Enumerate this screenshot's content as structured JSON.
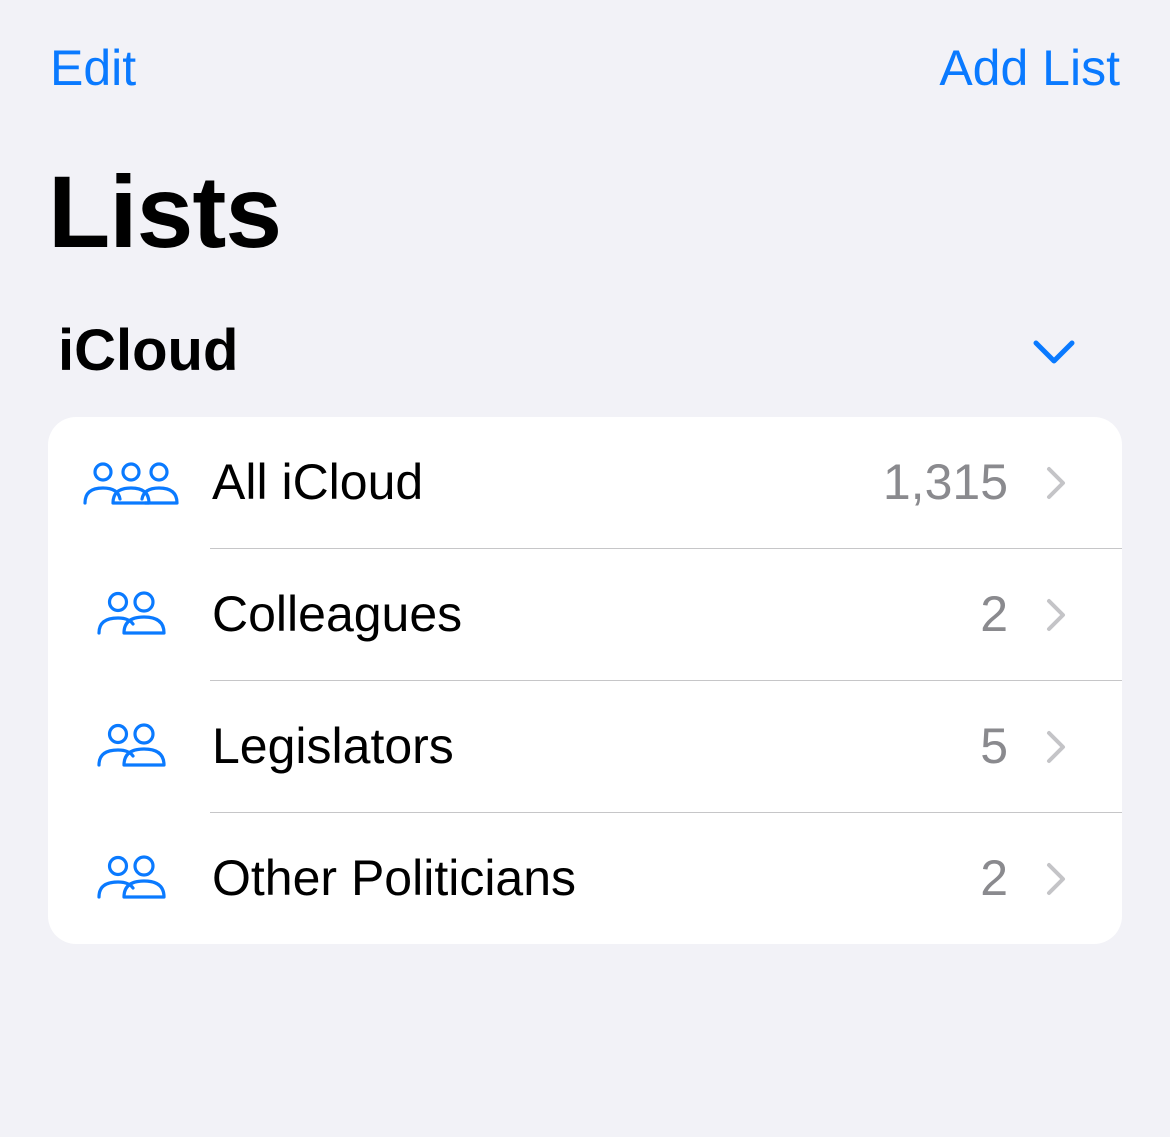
{
  "nav": {
    "edit_label": "Edit",
    "add_list_label": "Add List"
  },
  "page": {
    "title": "Lists"
  },
  "section": {
    "title": "iCloud",
    "expanded": true,
    "chevron_icon": "chevron-down-icon"
  },
  "lists": [
    {
      "label": "All iCloud",
      "count": "1,315",
      "icon": "three-people-icon"
    },
    {
      "label": "Colleagues",
      "count": "2",
      "icon": "two-people-icon"
    },
    {
      "label": "Legislators",
      "count": "5",
      "icon": "two-people-icon"
    },
    {
      "label": "Other Politicians",
      "count": "2",
      "icon": "two-people-icon"
    }
  ],
  "colors": {
    "accent": "#0a7aff",
    "background": "#f2f2f7",
    "card": "#ffffff",
    "secondary_text": "#8a8a8e",
    "row_chevron": "#c4c4c7",
    "divider": "#c6c6c8"
  }
}
